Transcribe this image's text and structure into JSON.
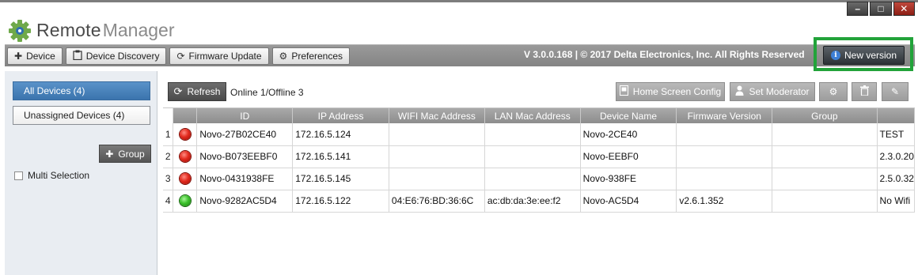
{
  "window": {
    "minimize": "–",
    "maximize": "□",
    "close": "✕"
  },
  "app": {
    "name_part1": "Remote",
    "name_part2": "Manager"
  },
  "toolbar": {
    "add_device": "Device",
    "device_discovery": "Device Discovery",
    "firmware_update": "Firmware Update",
    "preferences": "Preferences",
    "version_text": "V 3.0.0.168  |  © 2017 Delta Electronics, Inc. All Rights Reserved",
    "new_version": "New version"
  },
  "sidebar": {
    "all_devices": "All Devices (4)",
    "unassigned_devices": "Unassigned Devices (4)",
    "add_group": "Group",
    "multi_selection": "Multi Selection"
  },
  "main": {
    "refresh": "Refresh",
    "status": "Online 1/Offline 3",
    "home_screen_config": "Home Screen Config",
    "set_moderator": "Set Moderator"
  },
  "table": {
    "headers": [
      "ID",
      "IP Address",
      "WIFI Mac Address",
      "LAN Mac Address",
      "Device Name",
      "Firmware Version",
      "Group",
      ""
    ],
    "rows": [
      {
        "num": "1",
        "status": "red",
        "id": "Novo-27B02CE40",
        "ip": "172.16.5.124",
        "wifi": "",
        "lan": "",
        "name": "Novo-2CE40",
        "fw": "",
        "group": "",
        "extra": "TEST"
      },
      {
        "num": "2",
        "status": "red",
        "id": "Novo-B073EEBF0",
        "ip": "172.16.5.141",
        "wifi": "",
        "lan": "",
        "name": "Novo-EEBF0",
        "fw": "",
        "group": "",
        "extra": "2.3.0.20"
      },
      {
        "num": "3",
        "status": "red",
        "id": "Novo-0431938FE",
        "ip": "172.16.5.145",
        "wifi": "",
        "lan": "",
        "name": "Novo-938FE",
        "fw": "",
        "group": "",
        "extra": "2.5.0.32"
      },
      {
        "num": "4",
        "status": "green",
        "id": "Novo-9282AC5D4",
        "ip": "172.16.5.122",
        "wifi": "04:E6:76:BD:36:6C",
        "lan": "ac:db:da:3e:ee:f2",
        "name": "Novo-AC5D4",
        "fw": "v2.6.1.352",
        "group": "",
        "extra": "No Wifi"
      }
    ]
  },
  "colors": {
    "accent_blue": "#4a84bd",
    "highlight_green": "#22a33a",
    "offline": "#e22a1e",
    "online": "#3cc12c"
  }
}
